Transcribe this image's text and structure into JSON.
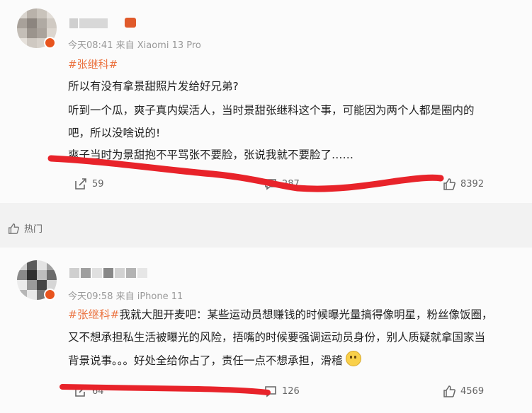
{
  "post1": {
    "meta": "今天08:41  来自 Xiaomi 13 Pro",
    "topic": "#张继科#",
    "lines": [
      "所以有没有拿景甜照片发给好兄弟?",
      "听到一个瓜，爽子真内娱活人，当时景甜张继科这个事，可能因为两个人都是圈内的",
      "吧，所以没啥说的!",
      "爽子当时为景甜抱不平骂张不要脸，张说我就不要脸了……"
    ],
    "repost_count": "59",
    "comment_count": "287",
    "like_count": "8392"
  },
  "hot": {
    "label": "热门"
  },
  "post2": {
    "meta": "今天09:58  来自 iPhone 11",
    "topic": "#张继科#",
    "line1_rest": "我就大胆开麦吧：某些运动员想赚钱的时候曝光量搞得像明星，粉丝像饭圈，",
    "line2": "又不想承担私生活被曝光的风险，捂嘴的时候要强调运动员身份，别人质疑就拿国家当",
    "line3": "背景说事。。。好处全给你占了，责任一点不想承担，滑稽",
    "repost_count": "64",
    "comment_count": "126",
    "like_count": "4569"
  },
  "colors": {
    "accent": "#eb7340",
    "annotation": "#e8232a"
  }
}
